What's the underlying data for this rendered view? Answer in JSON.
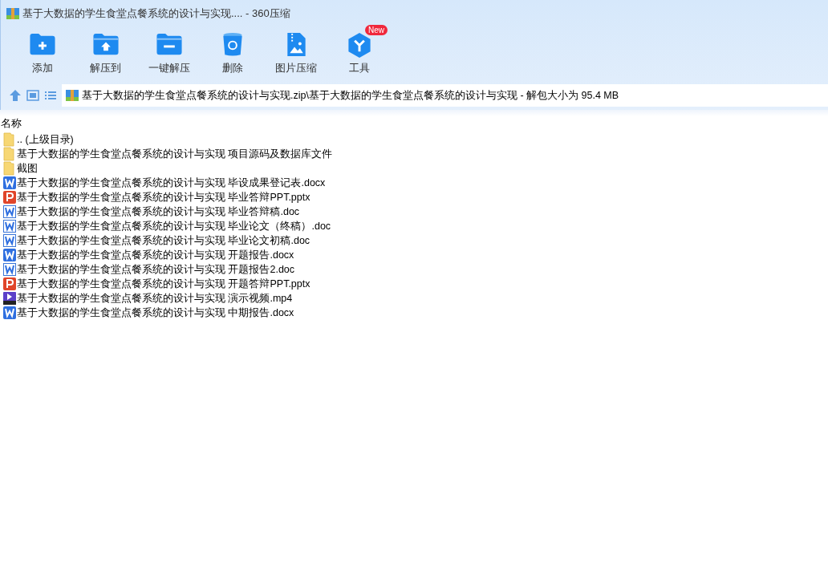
{
  "window": {
    "title": "基于大数据的学生食堂点餐系统的设计与实现.... - 360压缩"
  },
  "toolbar": [
    {
      "label": "添加",
      "kind": "add"
    },
    {
      "label": "解压到",
      "kind": "extract"
    },
    {
      "label": "一键解压",
      "kind": "quick"
    },
    {
      "label": "删除",
      "kind": "delete"
    },
    {
      "label": "图片压缩",
      "kind": "image"
    },
    {
      "label": "工具",
      "kind": "tools",
      "badge": "New"
    }
  ],
  "path": "基于大数据的学生食堂点餐系统的设计与实现.zip\\基于大数据的学生食堂点餐系统的设计与实现 - 解包大小为 95.4 MB",
  "columns": [
    "名称"
  ],
  "files": [
    {
      "name": ".. (上级目录)",
      "kind": "folder"
    },
    {
      "name": "基于大数据的学生食堂点餐系统的设计与实现 项目源码及数据库文件",
      "kind": "folder"
    },
    {
      "name": "截图",
      "kind": "folder"
    },
    {
      "name": "基于大数据的学生食堂点餐系统的设计与实现 毕设成果登记表.docx",
      "kind": "docx"
    },
    {
      "name": "基于大数据的学生食堂点餐系统的设计与实现 毕业答辩PPT.pptx",
      "kind": "pptx"
    },
    {
      "name": "基于大数据的学生食堂点餐系统的设计与实现 毕业答辩稿.doc",
      "kind": "doc"
    },
    {
      "name": "基于大数据的学生食堂点餐系统的设计与实现 毕业论文（终稿）.doc",
      "kind": "doc"
    },
    {
      "name": "基于大数据的学生食堂点餐系统的设计与实现 毕业论文初稿.doc",
      "kind": "doc"
    },
    {
      "name": "基于大数据的学生食堂点餐系统的设计与实现 开题报告.docx",
      "kind": "docx"
    },
    {
      "name": "基于大数据的学生食堂点餐系统的设计与实现 开题报告2.doc",
      "kind": "doc"
    },
    {
      "name": "基于大数据的学生食堂点餐系统的设计与实现 开题答辩PPT.pptx",
      "kind": "pptx"
    },
    {
      "name": "基于大数据的学生食堂点餐系统的设计与实现 演示视频.mp4",
      "kind": "mp4"
    },
    {
      "name": "基于大数据的学生食堂点餐系统的设计与实现 中期报告.docx",
      "kind": "docx"
    }
  ]
}
